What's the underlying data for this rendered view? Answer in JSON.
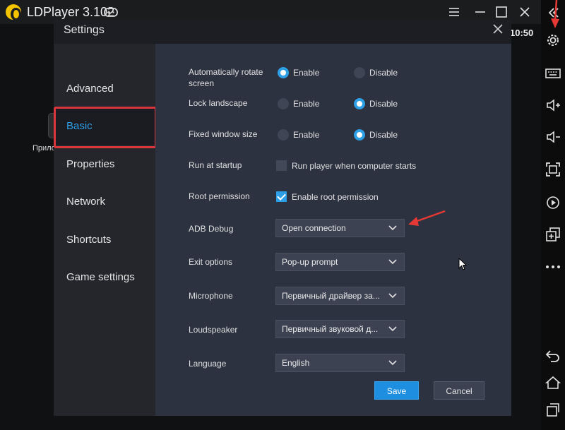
{
  "window": {
    "title": "LDPlayer 3.102",
    "clock": "10:50",
    "bg_app_label": "Прило"
  },
  "dialog": {
    "title": "Settings",
    "nav": [
      {
        "label": "Advanced"
      },
      {
        "label": "Basic"
      },
      {
        "label": "Properties"
      },
      {
        "label": "Network"
      },
      {
        "label": "Shortcuts"
      },
      {
        "label": "Game settings"
      }
    ],
    "active_nav": "Basic",
    "settings": {
      "auto_rotate": {
        "label": "Automatically rotate screen",
        "enable": "Enable",
        "disable": "Disable",
        "selected": "Enable"
      },
      "lock_landscape": {
        "label": "Lock landscape",
        "enable": "Enable",
        "disable": "Disable",
        "selected": "Disable"
      },
      "fixed_window": {
        "label": "Fixed window size",
        "enable": "Enable",
        "disable": "Disable",
        "selected": "Disable"
      },
      "run_at_startup": {
        "label": "Run at startup",
        "option": "Run player when computer starts",
        "checked": false
      },
      "root_permission": {
        "label": "Root permission",
        "option": "Enable root permission",
        "checked": true
      },
      "adb_debug": {
        "label": "ADB Debug",
        "value": "Open connection"
      },
      "exit_options": {
        "label": "Exit options",
        "value": "Pop-up prompt"
      },
      "microphone": {
        "label": "Microphone",
        "value": "Первичный драйвер за..."
      },
      "loudspeaker": {
        "label": "Loudspeaker",
        "value": "Первичный звуковой д..."
      },
      "language": {
        "label": "Language",
        "value": "English"
      }
    },
    "buttons": {
      "save": "Save",
      "cancel": "Cancel"
    }
  },
  "sidebar_icons": [
    "collapse-icon",
    "gear-icon",
    "keyboard-icon",
    "volume-up-icon",
    "volume-down-icon",
    "fullscreen-icon",
    "record-icon",
    "multi-instance-icon",
    "more-icon",
    "back-icon",
    "home-icon",
    "recent-apps-icon"
  ],
  "colors": {
    "accent": "#2d9fe6",
    "highlight": "#d9363e",
    "dialog_bg": "#2d3240",
    "nav_bg": "#24262c"
  }
}
